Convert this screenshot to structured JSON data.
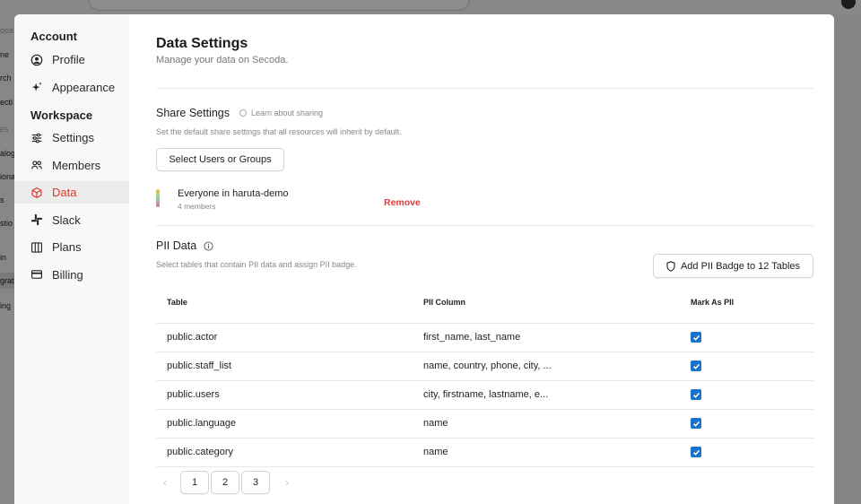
{
  "background": {
    "sidebar_fragments": [
      "OGE",
      "ne",
      "rch",
      "ecti",
      "ES",
      "alog",
      "iona",
      "s",
      "stio",
      "in",
      "grat",
      "ing"
    ]
  },
  "sidebar": {
    "account_heading": "Account",
    "workspace_heading": "Workspace",
    "account_items": [
      {
        "label": "Profile",
        "icon": "user-circle-icon"
      },
      {
        "label": "Appearance",
        "icon": "sparkles-icon"
      }
    ],
    "workspace_items": [
      {
        "label": "Settings",
        "icon": "sliders-icon"
      },
      {
        "label": "Members",
        "icon": "users-icon"
      },
      {
        "label": "Data",
        "icon": "cube-icon",
        "active": true
      },
      {
        "label": "Slack",
        "icon": "slack-icon"
      },
      {
        "label": "Plans",
        "icon": "columns-icon"
      },
      {
        "label": "Billing",
        "icon": "credit-card-icon"
      }
    ]
  },
  "main": {
    "title": "Data Settings",
    "subtitle": "Manage your data on Secoda.",
    "share": {
      "title": "Share Settings",
      "learn_link": "Learn about sharing",
      "description": "Set the default share settings that all resources will inherit by default.",
      "select_button": "Select Users or Groups",
      "member_name": "Everyone in haruta-demo",
      "member_count": "4 members",
      "remove_label": "Remove"
    },
    "pii": {
      "title": "PII Data",
      "description": "Select tables that contain PII data and assign PII badge.",
      "badge_button": "Add PII Badge to 12 Tables",
      "columns": [
        "Table",
        "PII Column",
        "Mark As PII"
      ],
      "rows": [
        {
          "table": "public.actor",
          "column": "first_name, last_name",
          "checked": true
        },
        {
          "table": "public.staff_list",
          "column": "name, country, phone, city, ...",
          "checked": true
        },
        {
          "table": "public.users",
          "column": "city, firstname, lastname, e...",
          "checked": true
        },
        {
          "table": "public.language",
          "column": "name",
          "checked": true
        },
        {
          "table": "public.category",
          "column": "name",
          "checked": true
        }
      ],
      "pages": [
        "1",
        "2",
        "3"
      ],
      "current_page": "1"
    }
  },
  "colors": {
    "accent_red": "#e0362c",
    "checkbox_blue": "#1a73c8"
  }
}
